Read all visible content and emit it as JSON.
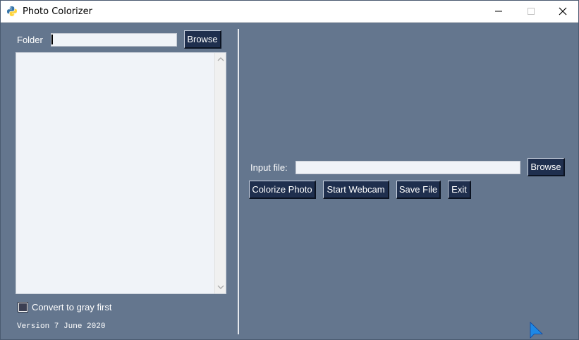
{
  "window": {
    "title": "Photo Colorizer",
    "controls": {
      "minimize": "minimize-icon",
      "maximize": "maximize-icon",
      "close": "close-icon"
    }
  },
  "folder": {
    "label": "Folder",
    "value": "",
    "browse_label": "Browse"
  },
  "file_list": {
    "items": []
  },
  "options": {
    "convert_gray_label": "Convert to gray first",
    "convert_gray_checked": false
  },
  "version": "Version 7 June 2020",
  "input_file": {
    "label": "Input file:",
    "value": "",
    "browse_label": "Browse"
  },
  "actions": {
    "colorize_label": "Colorize Photo",
    "webcam_label": "Start Webcam",
    "save_label": "Save File",
    "exit_label": "Exit"
  },
  "colors": {
    "background": "#64768e",
    "button": "#1f2f4e",
    "input": "#f0f3f8",
    "text": "#ffffff"
  }
}
